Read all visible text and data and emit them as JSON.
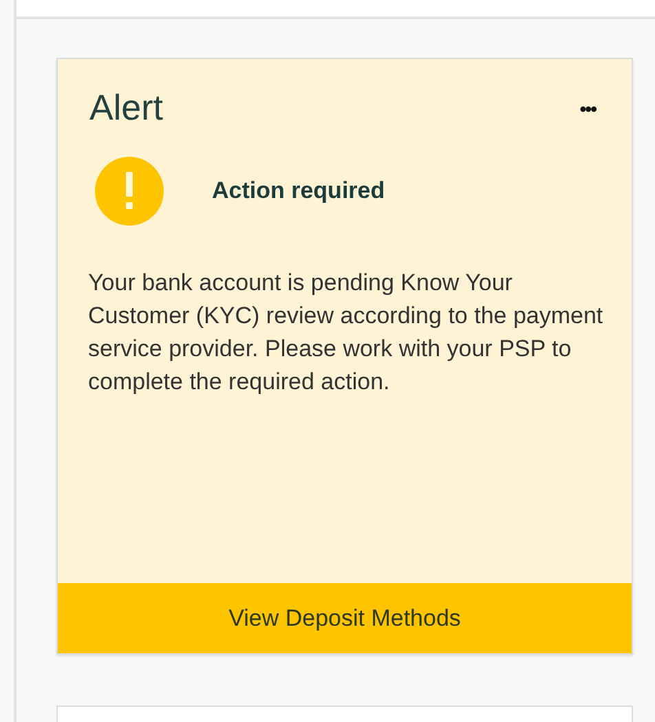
{
  "alert": {
    "title": "Alert",
    "menu": "•••",
    "status": "Action required",
    "message": "Your bank account is pending Know Your Customer (KYC) review according to the payment service provider. Please work with your PSP to complete the required action.",
    "action": "View Deposit Methods"
  }
}
